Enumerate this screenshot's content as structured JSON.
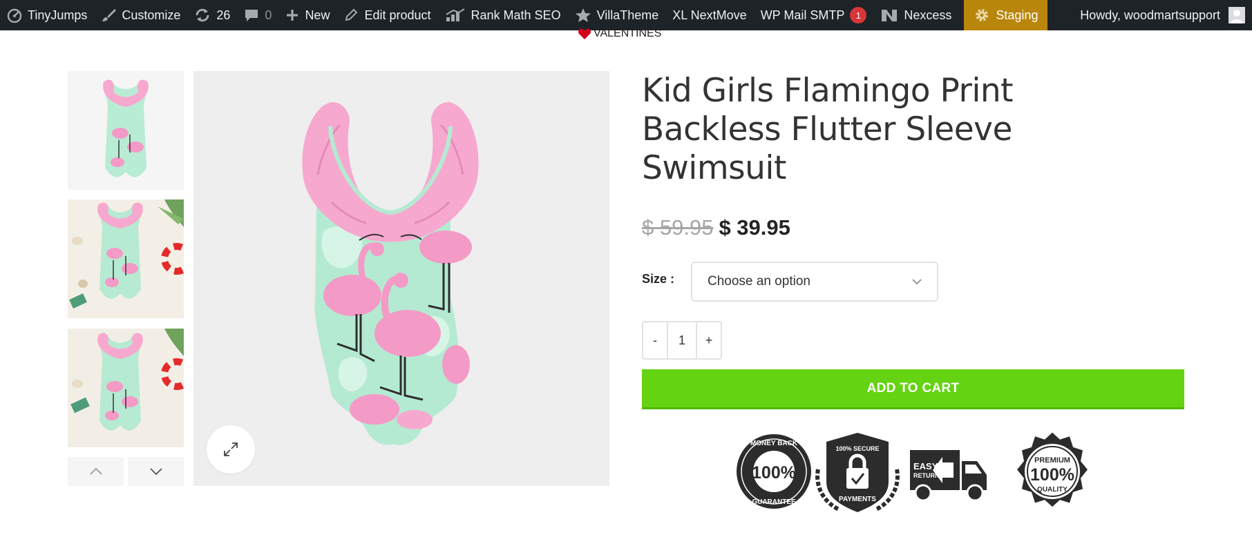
{
  "admin_bar": {
    "site_name": "TinyJumps",
    "customize": "Customize",
    "updates_count": "26",
    "comments_count": "0",
    "new_label": "New",
    "edit_product": "Edit product",
    "rank_math": "Rank Math SEO",
    "villatheme": "VillaTheme",
    "xl_nextmove": "XL NextMove",
    "wp_mail_smtp": "WP Mail SMTP",
    "wp_mail_smtp_badge": "1",
    "nexcess": "Nexcess",
    "staging": "Staging",
    "howdy": "Howdy, woodmartsupport"
  },
  "promo": {
    "text": "VALENTINES"
  },
  "gallery": {
    "prev_icon": "chevron-up-icon",
    "next_icon": "chevron-down-icon",
    "zoom_icon": "expand-icon"
  },
  "product": {
    "title_lines": [
      "Kid Girls Flamingo Print",
      "Backless Flutter Sleeve",
      "Swimsuit"
    ],
    "price_old": "$ 59.95",
    "price_new": "$ 39.95",
    "size_label": "Size :",
    "size_placeholder": "Choose an option",
    "qty_minus": "-",
    "qty_value": "1",
    "qty_plus": "+",
    "add_to_cart": "ADD TO CART"
  },
  "trust_badges": {
    "money_back": {
      "percent": "100%",
      "top": "MONEY BACK",
      "bottom": "GUARANTEE"
    },
    "secure": {
      "top": "100% SECURE",
      "bottom": "PAYMENTS"
    },
    "easy_return": {
      "line1": "EASY",
      "line2": "RETURN"
    },
    "premium": {
      "top": "PREMIUM",
      "percent": "100%",
      "bottom": "QUALITY"
    }
  },
  "colors": {
    "admin_bar_bg": "#1d2327",
    "staging_bg": "#b8860b",
    "add_to_cart_bg": "#64d311",
    "price_old": "#a5a5a5",
    "badge_red": "#d63638",
    "swimsuit_mint": "#a8e6c8",
    "flamingo_pink": "#f39ac7"
  }
}
